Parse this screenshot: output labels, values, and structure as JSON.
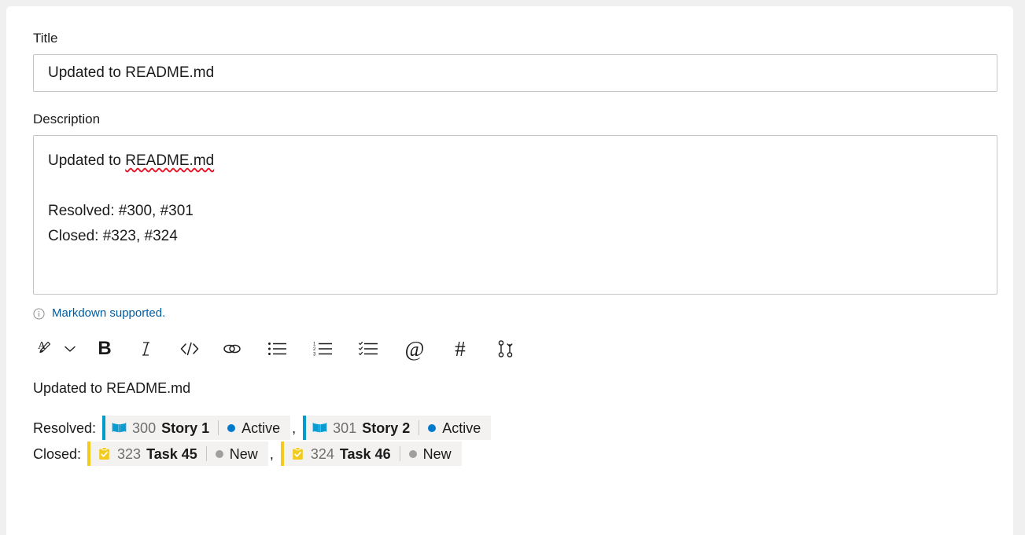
{
  "form": {
    "title_label": "Title",
    "title_value": "Updated to README.md",
    "description_label": "Description",
    "description_line1_prefix": "Updated to ",
    "description_line1_misspelled": "README.md",
    "description_line2": "Resolved: #300, #301",
    "description_line3": "Closed: #323, #324",
    "markdown_note": "Markdown supported.",
    "info_icon": "info-circle-icon"
  },
  "toolbar": {
    "items": [
      {
        "name": "font-style-icon",
        "glyph": "A"
      },
      {
        "name": "chevron-down-icon",
        "glyph": "v"
      },
      {
        "name": "bold-icon",
        "glyph": "B"
      },
      {
        "name": "italic-icon",
        "glyph": "I"
      },
      {
        "name": "code-icon",
        "glyph": "</>"
      },
      {
        "name": "link-icon",
        "glyph": "link"
      },
      {
        "name": "bulleted-list-icon",
        "glyph": "list"
      },
      {
        "name": "numbered-list-icon",
        "glyph": "1-2-3"
      },
      {
        "name": "checklist-icon",
        "glyph": "checklist"
      },
      {
        "name": "mention-icon",
        "glyph": "@"
      },
      {
        "name": "work-item-icon",
        "glyph": "#"
      },
      {
        "name": "pull-request-icon",
        "glyph": "pr"
      }
    ]
  },
  "preview": {
    "paragraph": "Updated to README.md",
    "rows": [
      {
        "label": "Resolved:",
        "items": [
          {
            "icon": "story-book-icon",
            "id": "300",
            "title": "Story 1",
            "state": "Active",
            "state_color": "#007acc",
            "accent": "#009ccc",
            "type": "story"
          },
          {
            "icon": "story-book-icon",
            "id": "301",
            "title": "Story 2",
            "state": "Active",
            "state_color": "#007acc",
            "accent": "#009ccc",
            "type": "story"
          }
        ],
        "separator": ","
      },
      {
        "label": "Closed:",
        "items": [
          {
            "icon": "task-clipboard-icon",
            "id": "323",
            "title": "Task 45",
            "state": "New",
            "state_color": "#a19f9d",
            "accent": "#f2cb1d",
            "type": "task"
          },
          {
            "icon": "task-clipboard-icon",
            "id": "324",
            "title": "Task 46",
            "state": "New",
            "state_color": "#a19f9d",
            "accent": "#f2cb1d",
            "type": "task"
          }
        ],
        "separator": ","
      }
    ]
  },
  "colors": {
    "link": "#005a9e",
    "story_accent": "#009ccc",
    "task_accent": "#f2cb1d",
    "active_state": "#007acc",
    "new_state": "#a19f9d",
    "chip_bg": "#f3f2f1",
    "border": "#c8c6c4",
    "spellcheck": "#e81123"
  }
}
